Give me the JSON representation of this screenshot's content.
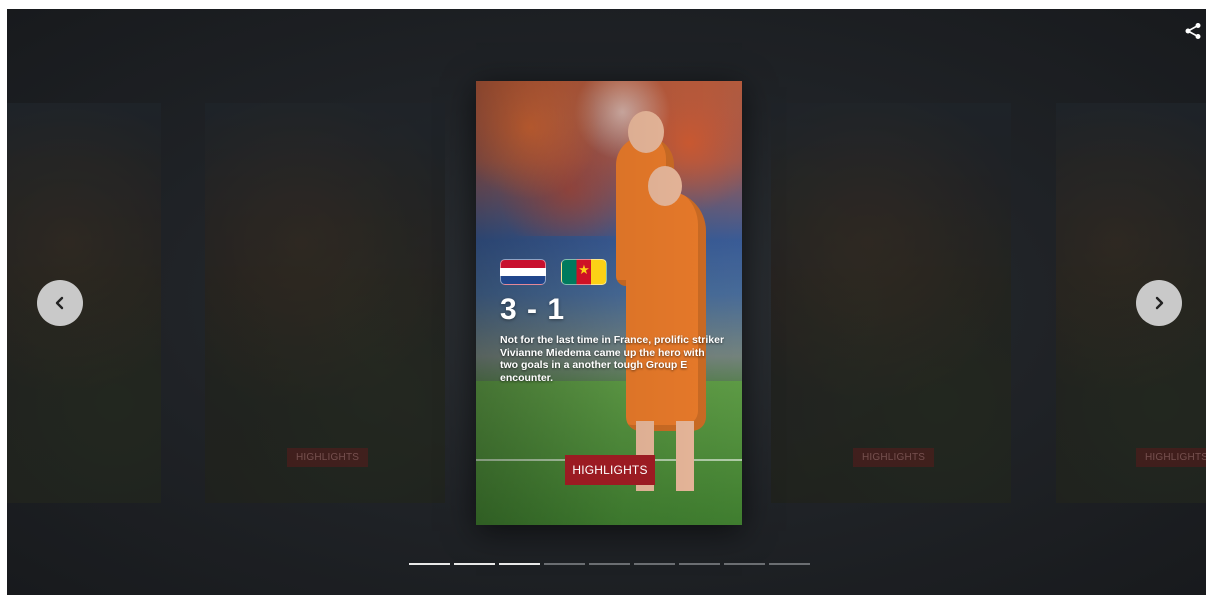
{
  "carousel": {
    "side_cards": [
      {
        "button_label": ""
      },
      {
        "button_label": "HIGHLIGHTS"
      },
      {
        "button_label": "HIGHLIGHTS"
      },
      {
        "button_label": "HIGHLIGHTS"
      }
    ],
    "active_card": {
      "home_flag": "Netherlands",
      "away_flag": "Cameroon",
      "score": "3 - 1",
      "description": "Not for the last time in France, prolific striker Vivianne Miedema came up the hero with two goals in a another tough Group E encounter.",
      "button_label": "HIGHLIGHTS"
    },
    "nav": {
      "prev_icon": "chevron-left-icon",
      "next_icon": "chevron-right-icon"
    },
    "share_icon": "share-icon",
    "progress": {
      "total": 9,
      "completed": 3
    }
  },
  "colors": {
    "accent": "#9b1b22",
    "background": "#1f2226",
    "nav_button": "#c9c9c9"
  }
}
